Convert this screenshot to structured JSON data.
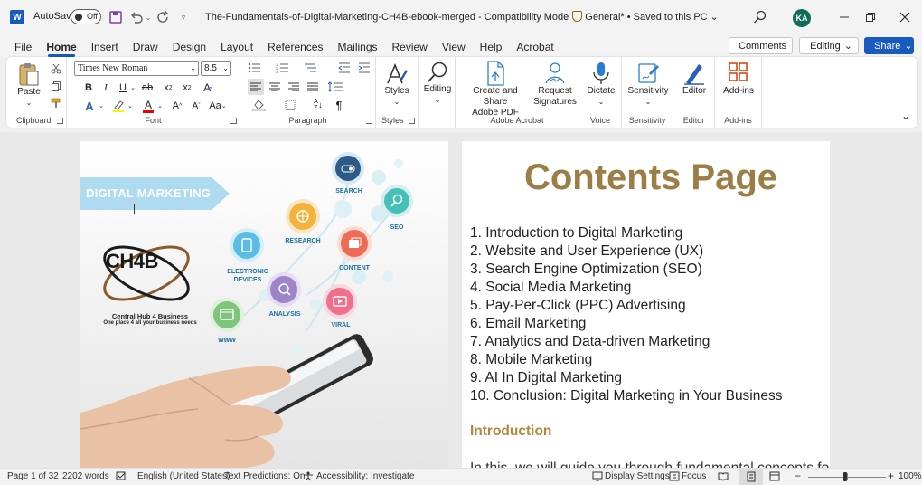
{
  "titlebar": {
    "app_logo": "W",
    "autosave_label": "AutoSave",
    "autosave_state": "Off",
    "doc_title": "The-Fundamentals-of-Digital-Marketing-CH4B-ebook-merged",
    "mode": "Compatibility Mode",
    "sensitivity": "General*",
    "save_status": "Saved to this PC",
    "user_initials": "KA"
  },
  "menu": {
    "tabs": [
      "File",
      "Home",
      "Insert",
      "Draw",
      "Design",
      "Layout",
      "References",
      "Mailings",
      "Review",
      "View",
      "Help",
      "Acrobat"
    ],
    "active": "Home",
    "comments_label": "Comments",
    "editing_label": "Editing",
    "share_label": "Share"
  },
  "ribbon": {
    "clipboard": {
      "paste_label": "Paste",
      "group_label": "Clipboard"
    },
    "font": {
      "font_name": "Times New Roman",
      "font_size": "8.5",
      "group_label": "Font"
    },
    "paragraph": {
      "group_label": "Paragraph"
    },
    "styles": {
      "styles_label": "Styles",
      "group_label": "Styles"
    },
    "editing": {
      "label": "Editing"
    },
    "acrobat": {
      "create_label_1": "Create and Share",
      "create_label_2": "Adobe PDF",
      "request_label_1": "Request",
      "request_label_2": "Signatures",
      "group_label": "Adobe Acrobat"
    },
    "voice": {
      "dictate_label": "Dictate",
      "group_label": "Voice"
    },
    "sensitivity": {
      "label": "Sensitivity",
      "group_label": "Sensitivity"
    },
    "editor": {
      "label": "Editor",
      "group_label": "Editor"
    },
    "addins": {
      "label": "Add-ins",
      "group_label": "Add-ins"
    }
  },
  "left_page": {
    "banner": "DIGITAL MARKETING",
    "logo": "CH4B",
    "brand_name": "Central Hub 4 Business",
    "tagline": "One place 4 all your business needs",
    "bubbles": [
      "SEARCH",
      "SEO",
      "RESEARCH",
      "CONTENT",
      "ELECTRONIC DEVICES",
      "ANALYSIS",
      "VIRAL",
      "WWW"
    ]
  },
  "right_page": {
    "title": "Contents Page",
    "toc": [
      "1. Introduction to Digital Marketing",
      "2. Website and User Experience (UX)",
      "3. Search Engine Optimization (SEO)",
      "4. Social Media Marketing",
      "5. Pay-Per-Click (PPC) Advertising",
      "6. Email Marketing",
      "7. Analytics and Data-driven Marketing",
      "8. Mobile Marketing",
      "9. AI In Digital Marketing",
      "10. Conclusion: Digital Marketing in Your Business"
    ],
    "intro_heading": "Introduction",
    "body_start": "In this, we will guide you through fundamental concepts for"
  },
  "status": {
    "page": "Page 1 of 32",
    "words": "2202 words",
    "language": "English (United States)",
    "predictions": "Text Predictions: On",
    "accessibility": "Accessibility: Investigate",
    "display": "Display Settings",
    "focus": "Focus",
    "zoom": "100%",
    "zoom_fraction": 0.45
  },
  "colors": {
    "accent": "#185abd",
    "title_gold": "#9c7d45",
    "heading_gold": "#b4853a"
  }
}
